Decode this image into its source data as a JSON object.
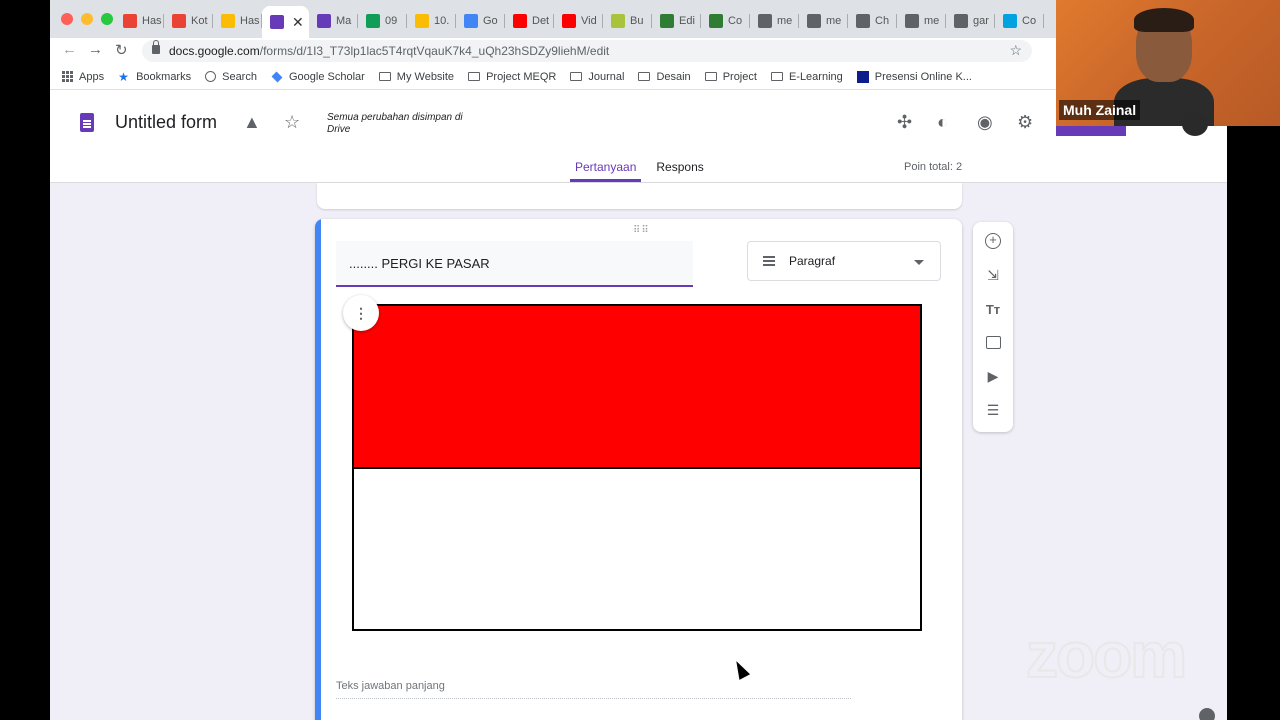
{
  "browser": {
    "tabs": [
      {
        "label": "Has",
        "icon": "gmail-icon",
        "color": "#ea4335"
      },
      {
        "label": "Kot",
        "icon": "gmail-icon",
        "color": "#ea4335"
      },
      {
        "label": "Has",
        "icon": "drive-icon",
        "color": "#fbbc04"
      },
      {
        "label": "",
        "icon": "forms-icon",
        "color": "#673ab7",
        "active": true
      },
      {
        "label": "Ma",
        "icon": "forms-icon",
        "color": "#673ab7"
      },
      {
        "label": "09",
        "icon": "classroom-icon",
        "color": "#0f9d58"
      },
      {
        "label": "10.",
        "icon": "drive-icon",
        "color": "#fbbc04"
      },
      {
        "label": "Go",
        "icon": "docs-icon",
        "color": "#4285f4"
      },
      {
        "label": "Det",
        "icon": "youtube-icon",
        "color": "#ff0000"
      },
      {
        "label": "Vid",
        "icon": "youtube-icon",
        "color": "#ff0000"
      },
      {
        "label": "Bu",
        "icon": "keep-icon",
        "color": "#a8c33c"
      },
      {
        "label": "Edi",
        "icon": "site-icon",
        "color": "#2e7d32"
      },
      {
        "label": "Co",
        "icon": "site-icon",
        "color": "#2e7d32"
      },
      {
        "label": "me",
        "icon": "google-icon",
        "color": "#5f6368"
      },
      {
        "label": "me",
        "icon": "google-icon",
        "color": "#5f6368"
      },
      {
        "label": "Ch",
        "icon": "link-icon",
        "color": "#5f6368"
      },
      {
        "label": "me",
        "icon": "google-icon",
        "color": "#5f6368"
      },
      {
        "label": "gar",
        "icon": "google-icon",
        "color": "#5f6368"
      },
      {
        "label": "Co",
        "icon": "qbox-icon",
        "color": "#00a3e0"
      }
    ],
    "url_host": "docs.google.com",
    "url_path": "/forms/d/1I3_T73lp1lac5T4rqtVqauK7k4_uQh23hSDZy9liehM/edit",
    "bookmarks": [
      {
        "label": "Apps",
        "icon": "apps-grid-icon"
      },
      {
        "label": "Bookmarks",
        "icon": "star-icon"
      },
      {
        "label": "Search",
        "icon": "search-icon"
      },
      {
        "label": "Google Scholar",
        "icon": "scholar-icon"
      },
      {
        "label": "My Website",
        "icon": "folder-icon"
      },
      {
        "label": "Project MEQR",
        "icon": "folder-icon"
      },
      {
        "label": "Journal",
        "icon": "folder-icon"
      },
      {
        "label": "Desain",
        "icon": "folder-icon"
      },
      {
        "label": "Project",
        "icon": "folder-icon"
      },
      {
        "label": "E-Learning",
        "icon": "folder-icon"
      },
      {
        "label": "Presensi Online K...",
        "icon": "site-icon"
      }
    ]
  },
  "form": {
    "title": "Untitled form",
    "save_status": "Semua perubahan disimpan di Drive",
    "tabs": [
      "Pertanyaan",
      "Respons"
    ],
    "points_total": "Poin total: 2",
    "question": {
      "text": "........ PERGI KE PASAR",
      "type": "Paragraf",
      "answer_placeholder": "Teks jawaban panjang"
    },
    "image": {
      "top_color": "#ff0000",
      "bottom_color": "#ffffff"
    }
  },
  "video": {
    "participant_name": "Muh Zainal"
  },
  "watermark": "zoom",
  "colors": {
    "accent": "#673ab7",
    "card_accent": "#4285f4"
  }
}
